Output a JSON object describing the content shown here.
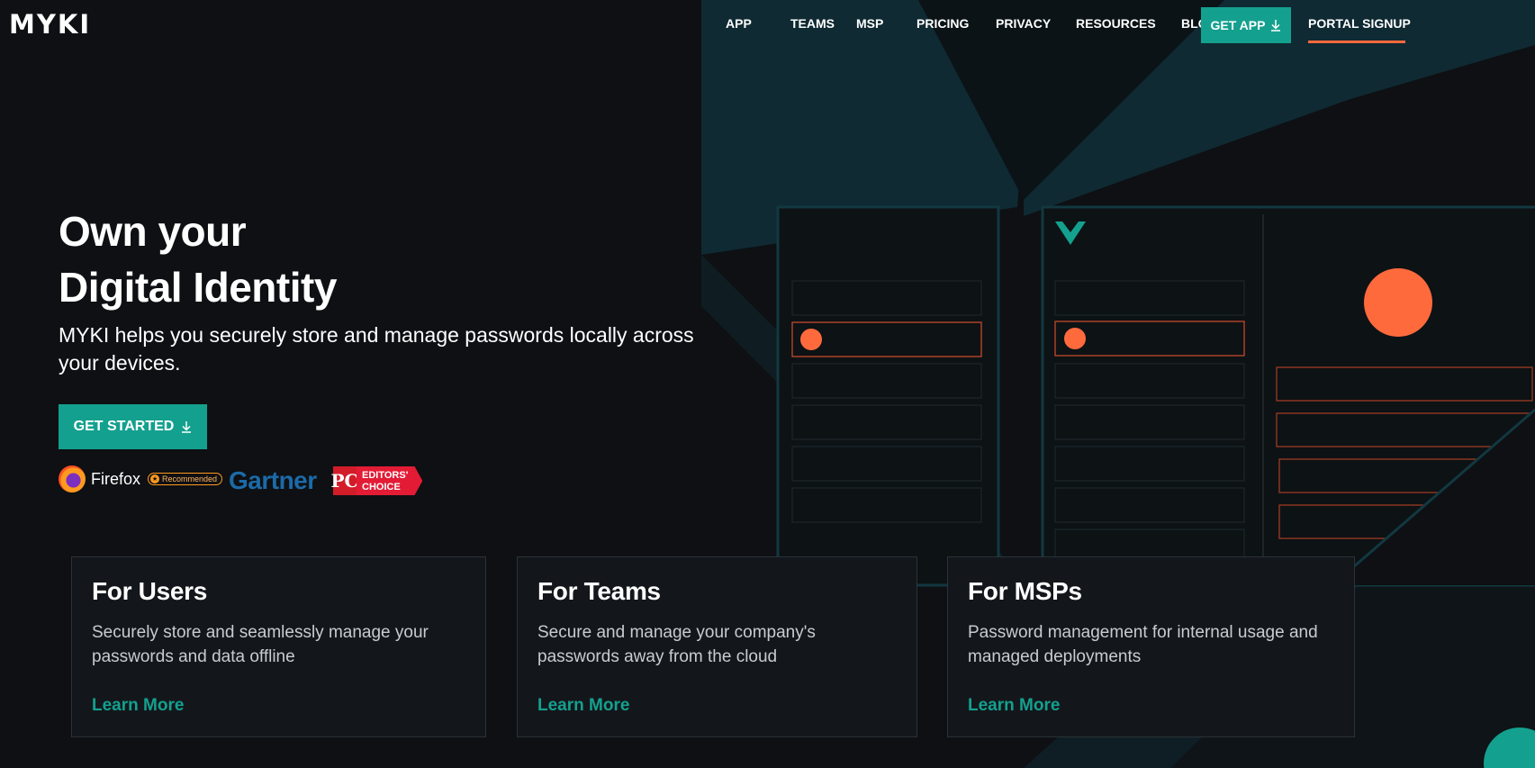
{
  "brand": {
    "logo_text": "MYKI"
  },
  "nav": {
    "items": [
      {
        "label": "APP"
      },
      {
        "label": "TEAMS"
      },
      {
        "label": "MSP"
      },
      {
        "label": "PRICING"
      },
      {
        "label": "PRIVACY"
      },
      {
        "label": "RESOURCES"
      },
      {
        "label": "BLOG"
      }
    ],
    "get_app_label": "GET APP",
    "portal_signup_label": "PORTAL SIGNUP"
  },
  "hero": {
    "title_line1": "Own your",
    "title_line2": "Digital Identity",
    "subtitle": "MYKI helps you securely store and manage passwords locally across your devices.",
    "cta_label": "GET STARTED"
  },
  "badges": {
    "firefox_name": "Firefox",
    "firefox_recommended": "Recommended",
    "gartner": "Gartner",
    "pc_mark": "PC",
    "pc_line1": "EDITORS'",
    "pc_line2": "CHOICE"
  },
  "cards": [
    {
      "title": "For Users",
      "description": "Securely store and seamlessly manage your passwords and data offline",
      "link": "Learn More"
    },
    {
      "title": "For Teams",
      "description": "Secure and manage your company's passwords away from the cloud",
      "link": "Learn More"
    },
    {
      "title": "For MSPs",
      "description": "Password management for internal usage and managed deployments",
      "link": "Learn More"
    }
  ],
  "icons": {
    "download": "download-icon",
    "myki_mark": "myki-mark-icon",
    "chat": "chat-icon"
  },
  "colors": {
    "accent": "#14a08f",
    "highlight": "#ff6a3d",
    "background": "#0e1013",
    "panel": "#0d1215",
    "teal_shade": "#0f2a33"
  }
}
